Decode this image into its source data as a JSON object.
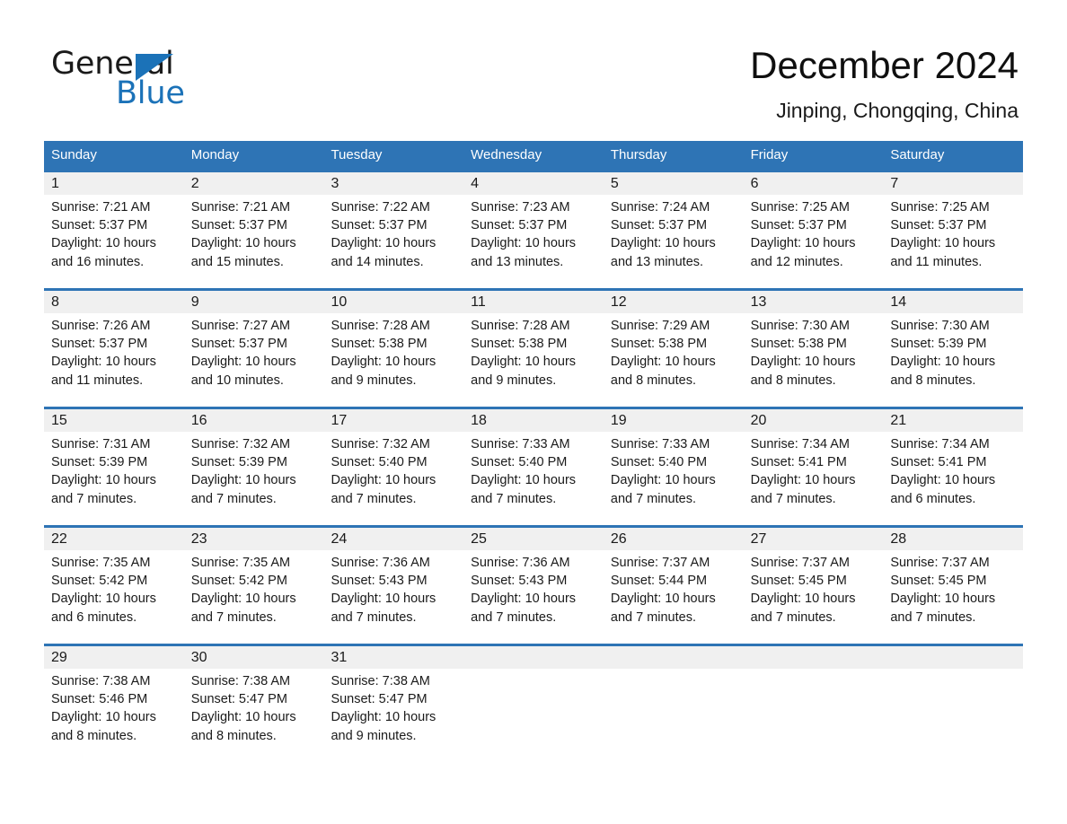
{
  "brand": {
    "name_part1": "General",
    "name_part2": "Blue",
    "accent_color": "#1b72b8"
  },
  "header": {
    "title": "December 2024",
    "subtitle": "Jinping, Chongqing, China"
  },
  "calendar": {
    "header_bg": "#2e74b5",
    "day_band_bg": "#f0f0f0",
    "weekdays": [
      "Sunday",
      "Monday",
      "Tuesday",
      "Wednesday",
      "Thursday",
      "Friday",
      "Saturday"
    ],
    "weeks": [
      [
        {
          "day": "1",
          "sunrise": "Sunrise: 7:21 AM",
          "sunset": "Sunset: 5:37 PM",
          "daylight_line1": "Daylight: 10 hours",
          "daylight_line2": "and 16 minutes."
        },
        {
          "day": "2",
          "sunrise": "Sunrise: 7:21 AM",
          "sunset": "Sunset: 5:37 PM",
          "daylight_line1": "Daylight: 10 hours",
          "daylight_line2": "and 15 minutes."
        },
        {
          "day": "3",
          "sunrise": "Sunrise: 7:22 AM",
          "sunset": "Sunset: 5:37 PM",
          "daylight_line1": "Daylight: 10 hours",
          "daylight_line2": "and 14 minutes."
        },
        {
          "day": "4",
          "sunrise": "Sunrise: 7:23 AM",
          "sunset": "Sunset: 5:37 PM",
          "daylight_line1": "Daylight: 10 hours",
          "daylight_line2": "and 13 minutes."
        },
        {
          "day": "5",
          "sunrise": "Sunrise: 7:24 AM",
          "sunset": "Sunset: 5:37 PM",
          "daylight_line1": "Daylight: 10 hours",
          "daylight_line2": "and 13 minutes."
        },
        {
          "day": "6",
          "sunrise": "Sunrise: 7:25 AM",
          "sunset": "Sunset: 5:37 PM",
          "daylight_line1": "Daylight: 10 hours",
          "daylight_line2": "and 12 minutes."
        },
        {
          "day": "7",
          "sunrise": "Sunrise: 7:25 AM",
          "sunset": "Sunset: 5:37 PM",
          "daylight_line1": "Daylight: 10 hours",
          "daylight_line2": "and 11 minutes."
        }
      ],
      [
        {
          "day": "8",
          "sunrise": "Sunrise: 7:26 AM",
          "sunset": "Sunset: 5:37 PM",
          "daylight_line1": "Daylight: 10 hours",
          "daylight_line2": "and 11 minutes."
        },
        {
          "day": "9",
          "sunrise": "Sunrise: 7:27 AM",
          "sunset": "Sunset: 5:37 PM",
          "daylight_line1": "Daylight: 10 hours",
          "daylight_line2": "and 10 minutes."
        },
        {
          "day": "10",
          "sunrise": "Sunrise: 7:28 AM",
          "sunset": "Sunset: 5:38 PM",
          "daylight_line1": "Daylight: 10 hours",
          "daylight_line2": "and 9 minutes."
        },
        {
          "day": "11",
          "sunrise": "Sunrise: 7:28 AM",
          "sunset": "Sunset: 5:38 PM",
          "daylight_line1": "Daylight: 10 hours",
          "daylight_line2": "and 9 minutes."
        },
        {
          "day": "12",
          "sunrise": "Sunrise: 7:29 AM",
          "sunset": "Sunset: 5:38 PM",
          "daylight_line1": "Daylight: 10 hours",
          "daylight_line2": "and 8 minutes."
        },
        {
          "day": "13",
          "sunrise": "Sunrise: 7:30 AM",
          "sunset": "Sunset: 5:38 PM",
          "daylight_line1": "Daylight: 10 hours",
          "daylight_line2": "and 8 minutes."
        },
        {
          "day": "14",
          "sunrise": "Sunrise: 7:30 AM",
          "sunset": "Sunset: 5:39 PM",
          "daylight_line1": "Daylight: 10 hours",
          "daylight_line2": "and 8 minutes."
        }
      ],
      [
        {
          "day": "15",
          "sunrise": "Sunrise: 7:31 AM",
          "sunset": "Sunset: 5:39 PM",
          "daylight_line1": "Daylight: 10 hours",
          "daylight_line2": "and 7 minutes."
        },
        {
          "day": "16",
          "sunrise": "Sunrise: 7:32 AM",
          "sunset": "Sunset: 5:39 PM",
          "daylight_line1": "Daylight: 10 hours",
          "daylight_line2": "and 7 minutes."
        },
        {
          "day": "17",
          "sunrise": "Sunrise: 7:32 AM",
          "sunset": "Sunset: 5:40 PM",
          "daylight_line1": "Daylight: 10 hours",
          "daylight_line2": "and 7 minutes."
        },
        {
          "day": "18",
          "sunrise": "Sunrise: 7:33 AM",
          "sunset": "Sunset: 5:40 PM",
          "daylight_line1": "Daylight: 10 hours",
          "daylight_line2": "and 7 minutes."
        },
        {
          "day": "19",
          "sunrise": "Sunrise: 7:33 AM",
          "sunset": "Sunset: 5:40 PM",
          "daylight_line1": "Daylight: 10 hours",
          "daylight_line2": "and 7 minutes."
        },
        {
          "day": "20",
          "sunrise": "Sunrise: 7:34 AM",
          "sunset": "Sunset: 5:41 PM",
          "daylight_line1": "Daylight: 10 hours",
          "daylight_line2": "and 7 minutes."
        },
        {
          "day": "21",
          "sunrise": "Sunrise: 7:34 AM",
          "sunset": "Sunset: 5:41 PM",
          "daylight_line1": "Daylight: 10 hours",
          "daylight_line2": "and 6 minutes."
        }
      ],
      [
        {
          "day": "22",
          "sunrise": "Sunrise: 7:35 AM",
          "sunset": "Sunset: 5:42 PM",
          "daylight_line1": "Daylight: 10 hours",
          "daylight_line2": "and 6 minutes."
        },
        {
          "day": "23",
          "sunrise": "Sunrise: 7:35 AM",
          "sunset": "Sunset: 5:42 PM",
          "daylight_line1": "Daylight: 10 hours",
          "daylight_line2": "and 7 minutes."
        },
        {
          "day": "24",
          "sunrise": "Sunrise: 7:36 AM",
          "sunset": "Sunset: 5:43 PM",
          "daylight_line1": "Daylight: 10 hours",
          "daylight_line2": "and 7 minutes."
        },
        {
          "day": "25",
          "sunrise": "Sunrise: 7:36 AM",
          "sunset": "Sunset: 5:43 PM",
          "daylight_line1": "Daylight: 10 hours",
          "daylight_line2": "and 7 minutes."
        },
        {
          "day": "26",
          "sunrise": "Sunrise: 7:37 AM",
          "sunset": "Sunset: 5:44 PM",
          "daylight_line1": "Daylight: 10 hours",
          "daylight_line2": "and 7 minutes."
        },
        {
          "day": "27",
          "sunrise": "Sunrise: 7:37 AM",
          "sunset": "Sunset: 5:45 PM",
          "daylight_line1": "Daylight: 10 hours",
          "daylight_line2": "and 7 minutes."
        },
        {
          "day": "28",
          "sunrise": "Sunrise: 7:37 AM",
          "sunset": "Sunset: 5:45 PM",
          "daylight_line1": "Daylight: 10 hours",
          "daylight_line2": "and 7 minutes."
        }
      ],
      [
        {
          "day": "29",
          "sunrise": "Sunrise: 7:38 AM",
          "sunset": "Sunset: 5:46 PM",
          "daylight_line1": "Daylight: 10 hours",
          "daylight_line2": "and 8 minutes."
        },
        {
          "day": "30",
          "sunrise": "Sunrise: 7:38 AM",
          "sunset": "Sunset: 5:47 PM",
          "daylight_line1": "Daylight: 10 hours",
          "daylight_line2": "and 8 minutes."
        },
        {
          "day": "31",
          "sunrise": "Sunrise: 7:38 AM",
          "sunset": "Sunset: 5:47 PM",
          "daylight_line1": "Daylight: 10 hours",
          "daylight_line2": "and 9 minutes."
        },
        {
          "day": "",
          "sunrise": "",
          "sunset": "",
          "daylight_line1": "",
          "daylight_line2": ""
        },
        {
          "day": "",
          "sunrise": "",
          "sunset": "",
          "daylight_line1": "",
          "daylight_line2": ""
        },
        {
          "day": "",
          "sunrise": "",
          "sunset": "",
          "daylight_line1": "",
          "daylight_line2": ""
        },
        {
          "day": "",
          "sunrise": "",
          "sunset": "",
          "daylight_line1": "",
          "daylight_line2": ""
        }
      ]
    ]
  }
}
